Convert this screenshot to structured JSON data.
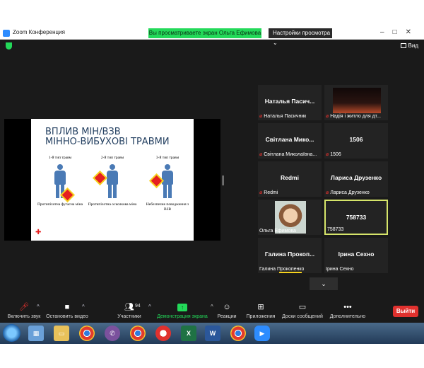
{
  "window": {
    "title": "Zoom Конференция"
  },
  "banner": {
    "sharing_text": "Вы просматриваете экран Ольга Ефимова",
    "view_options_label": "Настройки просмотра ⌄"
  },
  "header": {
    "view_label": "Вид"
  },
  "slide": {
    "title_line1": "ВПЛИВ МІН/ВЗВ",
    "title_line2": "МІННО-ВИБУХОВІ ТРАВМИ",
    "types": [
      {
        "heading": "1-й тип травм",
        "caption": "Протипіхотна фугасна міна"
      },
      {
        "heading": "2-й тип травм",
        "caption": "Протипіхотна осколкова міна"
      },
      {
        "heading": "3-й тип травм",
        "caption": "Небезпечне поводження з ВЗВ"
      }
    ]
  },
  "participants": [
    {
      "big": "Наталья  Пасич...",
      "label": "Наталья Пасичник",
      "muted": true
    },
    {
      "big": "",
      "label": "Надія і житло для дт...",
      "muted": true
    },
    {
      "big": "Світлана  Мико...",
      "label": "Світлана Миколаївна...",
      "muted": true
    },
    {
      "big": "1506",
      "label": "1506",
      "muted": true
    },
    {
      "big": "Redmi",
      "label": "Redmi",
      "muted": true
    },
    {
      "big": "Лариса Друзенко",
      "label": "Лариса Друзенко",
      "muted": true
    },
    {
      "big": "",
      "label": "Ольга Ефимова",
      "muted": false
    },
    {
      "big": "758733",
      "label": "758733",
      "muted": true
    },
    {
      "big": "Галина  Прокоп...",
      "label": "Галина Прокопенко",
      "muted": false
    },
    {
      "big": "Ірина Сехно",
      "label": "Ірина Сехно",
      "muted": false
    }
  ],
  "toolbar": {
    "unmute": "Включить звук",
    "stop_video": "Остановить видео",
    "participants_count": "94",
    "participants": "Участники",
    "share_screen": "Демонстрация экрана",
    "reactions": "Реакции",
    "apps": "Приложения",
    "whiteboards": "Доски сообщений",
    "more": "Дополнительно",
    "leave": "Выйти"
  },
  "taskbar": {
    "apps": [
      "explorer",
      "folder",
      "chrome",
      "viber",
      "chrome",
      "opera",
      "excel",
      "word",
      "chrome",
      "zoom"
    ]
  },
  "colors": {
    "share_green": "#23d959",
    "leave_red": "#e0312e",
    "active_speaker": "#d6e56a",
    "mic_muted": "#e0312e"
  }
}
